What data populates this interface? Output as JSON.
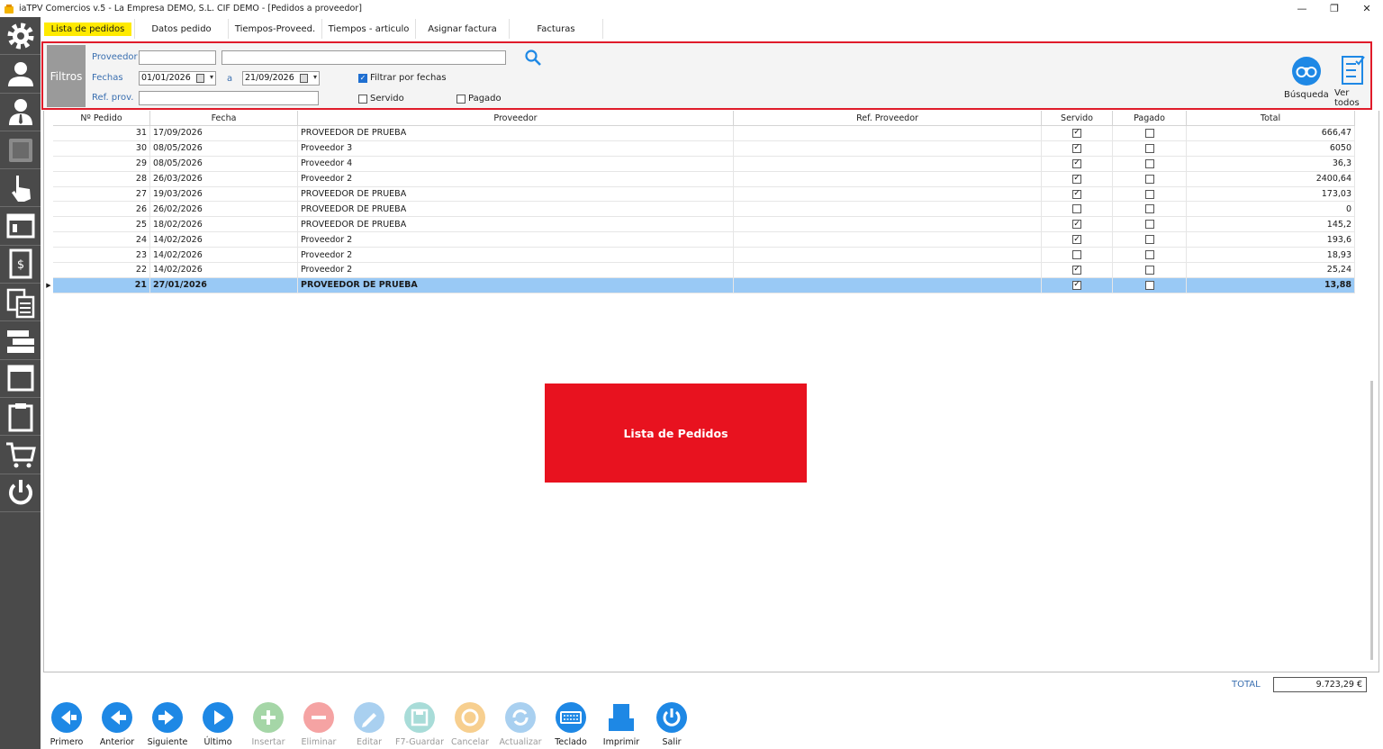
{
  "window": {
    "title": "iaTPV Comercios v.5 - La Empresa DEMO, S.L. CIF DEMO - [Pedidos a proveedor]",
    "minimize": "—",
    "maximize": "❐",
    "close": "✕"
  },
  "sidebar": {
    "icons": [
      "gear-icon",
      "user-icon",
      "user-tie-icon",
      "safe-icon",
      "hand-pointer-icon",
      "window-icon",
      "invoice-icon",
      "edit-documents-icon",
      "form-icon",
      "panel-icon",
      "clipboard-icon",
      "cart-icon",
      "power-icon"
    ]
  },
  "tabs": [
    {
      "label": "Lista de pedidos",
      "active": true
    },
    {
      "label": "Datos pedido"
    },
    {
      "label": "Tiempos-Proveed."
    },
    {
      "label": "Tiempos - articulo"
    },
    {
      "label": "Asignar factura"
    },
    {
      "label": "Facturas"
    }
  ],
  "filters": {
    "title": "Filtros",
    "proveedor_label": "Proveedor",
    "proveedor_code": "",
    "proveedor_name": "",
    "fechas_label": "Fechas",
    "fecha_desde": "01/01/2026",
    "a_label": "a",
    "fecha_hasta": "21/09/2026",
    "refprov_label": "Ref. prov.",
    "refprov_value": "",
    "filtrar_fechas_label": "Filtrar por fechas",
    "filtrar_fechas_checked": true,
    "servido_label": "Servido",
    "servido_checked": false,
    "pagado_label": "Pagado",
    "pagado_checked": false,
    "busqueda_label": "Búsqueda",
    "ver_todos_label": "Ver todos"
  },
  "grid": {
    "columns": [
      "Nº Pedido",
      "Fecha",
      "Proveedor",
      "Ref. Proveedor",
      "Servido",
      "Pagado",
      "Total"
    ],
    "rows": [
      {
        "num": "31",
        "fecha": "17/09/2026",
        "proveedor": "PROVEEDOR DE PRUEBA",
        "ref": "",
        "servido": true,
        "pagado": false,
        "total": "666,47"
      },
      {
        "num": "30",
        "fecha": "08/05/2026",
        "proveedor": "Proveedor 3",
        "ref": "",
        "servido": true,
        "pagado": false,
        "total": "6050"
      },
      {
        "num": "29",
        "fecha": "08/05/2026",
        "proveedor": "Proveedor 4",
        "ref": "",
        "servido": true,
        "pagado": false,
        "total": "36,3"
      },
      {
        "num": "28",
        "fecha": "26/03/2026",
        "proveedor": "Proveedor 2",
        "ref": "",
        "servido": true,
        "pagado": false,
        "total": "2400,64"
      },
      {
        "num": "27",
        "fecha": "19/03/2026",
        "proveedor": "PROVEEDOR DE PRUEBA",
        "ref": "",
        "servido": true,
        "pagado": false,
        "total": "173,03"
      },
      {
        "num": "26",
        "fecha": "26/02/2026",
        "proveedor": "PROVEEDOR DE PRUEBA",
        "ref": "",
        "servido": false,
        "pagado": false,
        "total": "0"
      },
      {
        "num": "25",
        "fecha": "18/02/2026",
        "proveedor": "PROVEEDOR DE PRUEBA",
        "ref": "",
        "servido": true,
        "pagado": false,
        "total": "145,2"
      },
      {
        "num": "24",
        "fecha": "14/02/2026",
        "proveedor": "Proveedor 2",
        "ref": "",
        "servido": true,
        "pagado": false,
        "total": "193,6"
      },
      {
        "num": "23",
        "fecha": "14/02/2026",
        "proveedor": "Proveedor 2",
        "ref": "",
        "servido": false,
        "pagado": false,
        "total": "18,93"
      },
      {
        "num": "22",
        "fecha": "14/02/2026",
        "proveedor": "Proveedor 2",
        "ref": "",
        "servido": true,
        "pagado": false,
        "total": "25,24"
      },
      {
        "num": "21",
        "fecha": "27/01/2026",
        "proveedor": "PROVEEDOR DE PRUEBA",
        "ref": "",
        "servido": true,
        "pagado": false,
        "total": "13,88",
        "selected": true
      }
    ]
  },
  "overlay": {
    "text": "Lista de Pedidos"
  },
  "totals": {
    "label": "TOTAL",
    "value": "9.723,29 €"
  },
  "toolbar": [
    {
      "label": "Primero",
      "icon": "first-arrow-icon",
      "color": "#1e88e5",
      "enabled": true
    },
    {
      "label": "Anterior",
      "icon": "prev-arrow-icon",
      "color": "#1e88e5",
      "enabled": true
    },
    {
      "label": "Siguiente",
      "icon": "next-arrow-icon",
      "color": "#1e88e5",
      "enabled": true
    },
    {
      "label": "Último",
      "icon": "last-arrow-icon",
      "color": "#1e88e5",
      "enabled": true
    },
    {
      "label": "Insertar",
      "icon": "plus-icon",
      "color": "#a5d6a7",
      "enabled": false
    },
    {
      "label": "Eliminar",
      "icon": "minus-icon",
      "color": "#f5a3a3",
      "enabled": false
    },
    {
      "label": "Editar",
      "icon": "pencil-icon",
      "color": "#a9d0f0",
      "enabled": false
    },
    {
      "label": "F7-Guardar",
      "icon": "save-icon",
      "color": "#a8dcd8",
      "enabled": false
    },
    {
      "label": "Cancelar",
      "icon": "cancel-icon",
      "color": "#f7cf8f",
      "enabled": false
    },
    {
      "label": "Actualizar",
      "icon": "refresh-icon",
      "color": "#a9d0f0",
      "enabled": false
    },
    {
      "label": "Teclado",
      "icon": "keyboard-icon",
      "color": "#1e88e5",
      "enabled": true
    },
    {
      "label": "Imprimir",
      "icon": "printer-icon",
      "color": "#1e88e5",
      "enabled": true
    },
    {
      "label": "Salir",
      "icon": "power-icon",
      "color": "#1e88e5",
      "enabled": true
    }
  ],
  "colors": {
    "accent": "#1e88e5",
    "tab_highlight": "#ffea00",
    "filter_border": "#e01b2a",
    "selection": "#99c9f5",
    "overlay": "#e8121f",
    "sidebar": "#4a4a4a"
  }
}
